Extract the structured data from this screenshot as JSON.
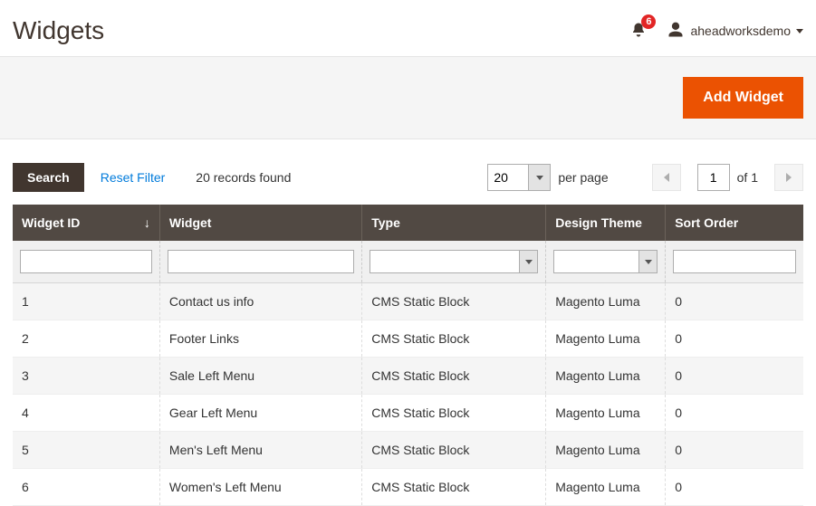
{
  "header": {
    "title": "Widgets",
    "notification_count": "6",
    "user_name": "aheadworksdemo"
  },
  "actions": {
    "add_widget": "Add Widget"
  },
  "toolbar": {
    "search_label": "Search",
    "reset_label": "Reset Filter",
    "records_found": "20 records found",
    "page_size": "20",
    "per_page_label": "per page",
    "current_page": "1",
    "of_label": "of",
    "total_pages": "1"
  },
  "columns": {
    "widget_id": "Widget ID",
    "widget": "Widget",
    "type": "Type",
    "design_theme": "Design Theme",
    "sort_order": "Sort Order",
    "sort_indicator": "↓"
  },
  "rows": [
    {
      "id": "1",
      "widget": "Contact us info",
      "type": "CMS Static Block",
      "theme": "Magento Luma",
      "sort": "0"
    },
    {
      "id": "2",
      "widget": "Footer Links",
      "type": "CMS Static Block",
      "theme": "Magento Luma",
      "sort": "0"
    },
    {
      "id": "3",
      "widget": "Sale Left Menu",
      "type": "CMS Static Block",
      "theme": "Magento Luma",
      "sort": "0"
    },
    {
      "id": "4",
      "widget": "Gear Left Menu",
      "type": "CMS Static Block",
      "theme": "Magento Luma",
      "sort": "0"
    },
    {
      "id": "5",
      "widget": "Men's Left Menu",
      "type": "CMS Static Block",
      "theme": "Magento Luma",
      "sort": "0"
    },
    {
      "id": "6",
      "widget": "Women's Left Menu",
      "type": "CMS Static Block",
      "theme": "Magento Luma",
      "sort": "0"
    }
  ]
}
